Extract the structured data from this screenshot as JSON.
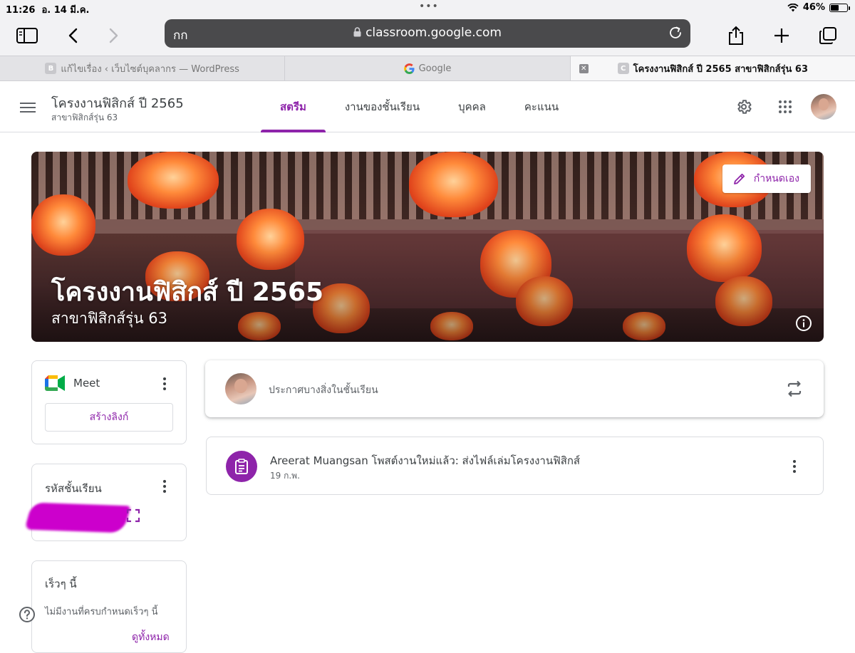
{
  "status_bar": {
    "time": "11:26",
    "date": "อ. 14 มี.ค.",
    "battery": "46%",
    "battery_level": 0.46
  },
  "safari": {
    "text_size_label": "กก",
    "url": "classroom.google.com",
    "tabs": [
      {
        "favicon": "B",
        "title": "แก้ไขเรื่อง ‹ เว็บไซต์บุคลากร — WordPress"
      },
      {
        "favicon": "G",
        "title": "Google"
      },
      {
        "favicon": "C",
        "title": "โครงงานฟิสิกส์ ปี 2565 สาขาฟิสิกส์รุ่น 63"
      }
    ]
  },
  "classroom": {
    "class_name": "โครงงานฟิสิกส์ ปี 2565",
    "section": "สาขาฟิสิกส์รุ่น 63",
    "nav": {
      "stream": "สตรีม",
      "classwork": "งานของชั้นเรียน",
      "people": "บุคคล",
      "grades": "คะแนน"
    },
    "accent_color": "#8e24aa",
    "banner": {
      "title": "โครงงานฟิสิกส์ ปี 2565",
      "subtitle": "สาขาฟิสิกส์รุ่น 63",
      "customize_label": "กำหนดเอง"
    },
    "meet": {
      "label": "Meet",
      "create_link_label": "สร้างลิงก์"
    },
    "class_code": {
      "label": "รหัสชั้นเรียน"
    },
    "upcoming": {
      "title": "เร็วๆ นี้",
      "empty_text": "ไม่มีงานที่ครบกำหนดเร็วๆ นี้",
      "view_all": "ดูทั้งหมด"
    },
    "announce_placeholder": "ประกาศบางสิ่งในชั้นเรียน",
    "posts": [
      {
        "title": "Areerat Muangsan โพสต์งานใหม่แล้ว: ส่งไฟล์เล่มโครงงานฟิสิกส์",
        "date": "19 ก.พ."
      }
    ]
  }
}
